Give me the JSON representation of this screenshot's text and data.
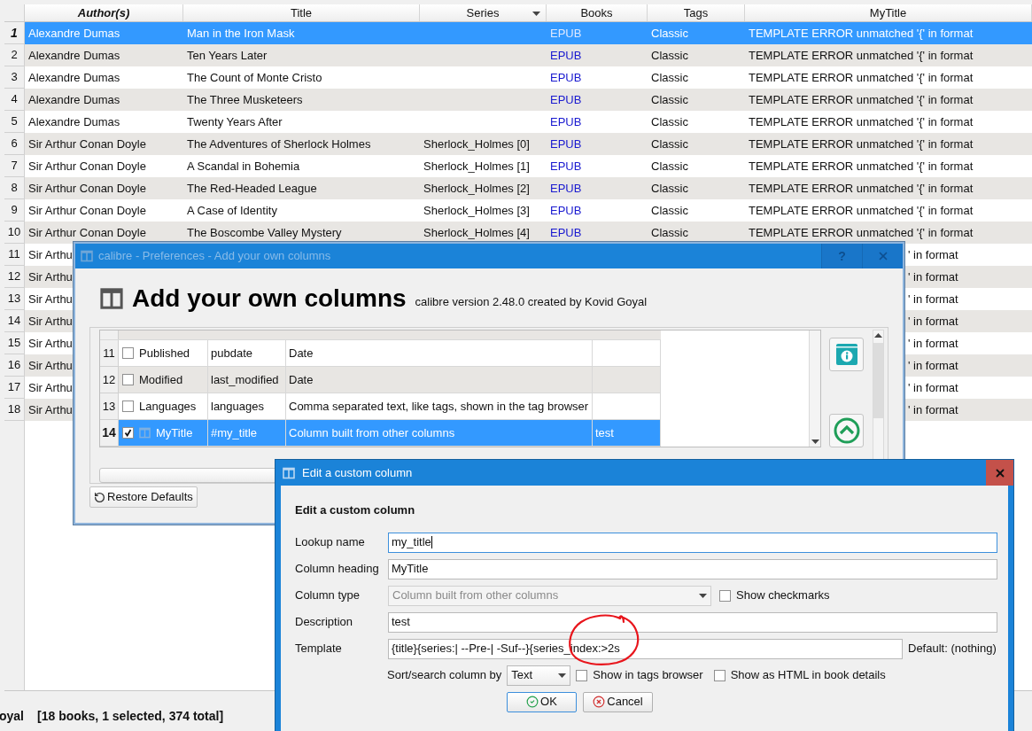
{
  "book_list": {
    "columns": [
      {
        "label": "Author(s)",
        "sorted": true
      },
      {
        "label": "Title",
        "sorted": false
      },
      {
        "label": "Series",
        "sorted": false,
        "menu": true
      },
      {
        "label": "Books",
        "sorted": false
      },
      {
        "label": "Tags",
        "sorted": false
      },
      {
        "label": "MyTitle",
        "sorted": false
      }
    ],
    "rows": [
      {
        "kind": "full",
        "number": "1",
        "selected": true,
        "cells": [
          "Alexandre Dumas",
          "Man in the Iron Mask",
          "",
          "EPUB",
          "Classic",
          "TEMPLATE ERROR unmatched '{' in format"
        ]
      },
      {
        "kind": "full",
        "number": "2",
        "selected": false,
        "cells": [
          "Alexandre Dumas",
          "Ten Years Later",
          "",
          "EPUB",
          "Classic",
          "TEMPLATE ERROR unmatched '{' in format"
        ]
      },
      {
        "kind": "full",
        "number": "3",
        "selected": false,
        "cells": [
          "Alexandre Dumas",
          "The Count of Monte Cristo",
          "",
          "EPUB",
          "Classic",
          "TEMPLATE ERROR unmatched '{' in format"
        ]
      },
      {
        "kind": "full",
        "number": "4",
        "selected": false,
        "cells": [
          "Alexandre Dumas",
          "The Three Musketeers",
          "",
          "EPUB",
          "Classic",
          "TEMPLATE ERROR unmatched '{' in format"
        ]
      },
      {
        "kind": "full",
        "number": "5",
        "selected": false,
        "cells": [
          "Alexandre Dumas",
          "Twenty Years After",
          "",
          "EPUB",
          "Classic",
          "TEMPLATE ERROR unmatched '{' in format"
        ]
      },
      {
        "kind": "full",
        "number": "6",
        "selected": false,
        "cells": [
          "Sir Arthur Conan Doyle",
          "The Adventures of Sherlock Holmes",
          "Sherlock_Holmes [0]",
          "EPUB",
          "Classic",
          "TEMPLATE ERROR unmatched '{' in format"
        ]
      },
      {
        "kind": "full",
        "number": "7",
        "selected": false,
        "cells": [
          "Sir Arthur Conan Doyle",
          "A Scandal in Bohemia",
          "Sherlock_Holmes [1]",
          "EPUB",
          "Classic",
          "TEMPLATE ERROR unmatched '{' in format"
        ]
      },
      {
        "kind": "full",
        "number": "8",
        "selected": false,
        "cells": [
          "Sir Arthur Conan Doyle",
          "The Red-Headed League",
          "Sherlock_Holmes [2]",
          "EPUB",
          "Classic",
          "TEMPLATE ERROR unmatched '{' in format"
        ]
      },
      {
        "kind": "full",
        "number": "9",
        "selected": false,
        "cells": [
          "Sir Arthur Conan Doyle",
          "A Case of Identity",
          "Sherlock_Holmes [3]",
          "EPUB",
          "Classic",
          "TEMPLATE ERROR unmatched '{' in format"
        ]
      },
      {
        "kind": "full",
        "number": "10",
        "selected": false,
        "cells": [
          "Sir Arthur Conan Doyle",
          "The Boscombe Valley Mystery",
          "Sherlock_Holmes [4]",
          "EPUB",
          "Classic",
          "TEMPLATE ERROR unmatched '{' in format"
        ]
      },
      {
        "kind": "covered",
        "number": "11",
        "selected": false,
        "author": "Sir Arthu",
        "mytitle": "' in format"
      },
      {
        "kind": "covered",
        "number": "12",
        "selected": false,
        "author": "Sir Arthu",
        "mytitle": "' in format"
      },
      {
        "kind": "covered",
        "number": "13",
        "selected": false,
        "author": "Sir Arthu",
        "mytitle": "' in format"
      },
      {
        "kind": "covered",
        "number": "14",
        "selected": false,
        "author": "Sir Arthu",
        "mytitle": "' in format"
      },
      {
        "kind": "covered",
        "number": "15",
        "selected": false,
        "author": "Sir Arthu",
        "mytitle": "' in format"
      },
      {
        "kind": "covered",
        "number": "16",
        "selected": false,
        "author": "Sir Arthu",
        "mytitle": "' in format"
      },
      {
        "kind": "covered",
        "number": "17",
        "selected": false,
        "author": "Sir Arthu",
        "mytitle": "' in format"
      },
      {
        "kind": "covered",
        "number": "18",
        "selected": false,
        "author": "Sir Arthu",
        "mytitle": "' in format"
      }
    ]
  },
  "status_bar": {
    "left": "oyal",
    "summary": "[18 books, 1 selected, 374 total]"
  },
  "preferences_dialog": {
    "title": "calibre - Preferences - Add your own columns",
    "help": "?",
    "heading": "Add your own columns",
    "version_text": "calibre version 2.48.0 created by Kovid Goyal",
    "rows": [
      {
        "kind": "builtin",
        "number": "11",
        "selected": false,
        "checked": false,
        "name": "Published",
        "lookup": "pubdate",
        "type": "Date",
        "heading": ""
      },
      {
        "kind": "builtin",
        "number": "12",
        "selected": false,
        "checked": false,
        "name": "Modified",
        "lookup": "last_modified",
        "type": "Date",
        "heading": ""
      },
      {
        "kind": "builtin",
        "number": "13",
        "selected": false,
        "checked": false,
        "name": "Languages",
        "lookup": "languages",
        "type": "Comma separated text, like tags, shown in the tag browser",
        "heading": ""
      },
      {
        "kind": "custom",
        "number": "14",
        "selected": true,
        "checked": true,
        "name": "MyTitle",
        "lookup": "#my_title",
        "type": "Column built from other columns",
        "heading": "test"
      }
    ],
    "restore_button": "Restore Defaults"
  },
  "edit_dialog": {
    "title": "Edit a custom column",
    "heading": "Edit a custom column",
    "fields": [
      {
        "kind": "text",
        "label": "Lookup name",
        "value": "my_title",
        "focused": true
      },
      {
        "kind": "text",
        "label": "Column heading",
        "value": "MyTitle",
        "focused": false
      },
      {
        "kind": "select",
        "label": "Column type",
        "value": "Column built from other columns",
        "disabled": true,
        "option": {
          "label": "Show checkmarks",
          "checked": false
        }
      },
      {
        "kind": "text",
        "label": "Description",
        "value": "test",
        "focused": false
      },
      {
        "kind": "template",
        "label": "Template",
        "value": "{title}{series:| --Pre-| -Suf--}{series_index:>2s",
        "focused": false,
        "note": "Default: (nothing)"
      }
    ],
    "sort_row": {
      "label": "Sort/search column by",
      "value": "Text",
      "checkboxes": [
        {
          "label": "Show in tags browser",
          "checked": false
        },
        {
          "label": "Show as HTML in book details",
          "checked": false
        }
      ]
    },
    "buttons": [
      {
        "kind": "ok",
        "label": "OK",
        "default": true
      },
      {
        "kind": "cancel",
        "label": "Cancel",
        "default": false
      }
    ]
  }
}
